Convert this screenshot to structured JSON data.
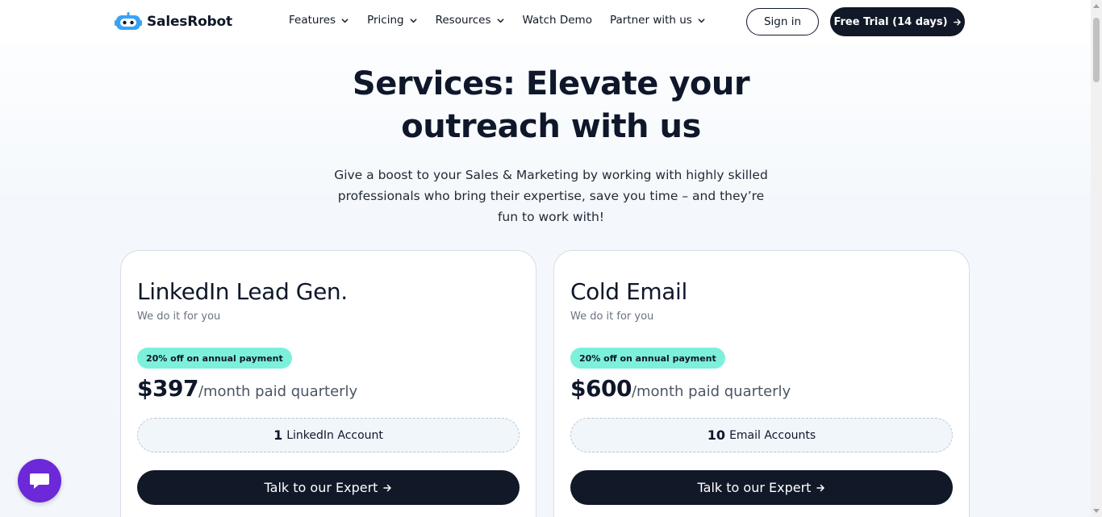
{
  "header": {
    "brand": "SalesRobot",
    "nav": [
      {
        "label": "Features",
        "has_dropdown": true
      },
      {
        "label": "Pricing",
        "has_dropdown": true
      },
      {
        "label": "Resources",
        "has_dropdown": true
      },
      {
        "label": "Watch Demo",
        "has_dropdown": false
      },
      {
        "label": "Partner with us",
        "has_dropdown": true
      }
    ],
    "signin_label": "Sign in",
    "trial_label": "Free Trial (14 days)"
  },
  "hero": {
    "title_line1": "Services: Elevate your",
    "title_line2": "outreach with us",
    "sub_line1": "Give a boost to your Sales & Marketing by working with highly skilled",
    "sub_line2": "professionals who bring their expertise, save you time – and they’re",
    "sub_line3": "fun to work with!"
  },
  "cards": [
    {
      "title": "LinkedIn Lead Gen.",
      "subtitle": "We do it for you",
      "badge": "20% off on annual payment",
      "price": "$397",
      "price_unit": "/month paid quarterly",
      "account_count": "1",
      "account_label": "LinkedIn Account",
      "cta": "Talk to our Expert"
    },
    {
      "title": "Cold Email",
      "subtitle": "We do it for you",
      "badge": "20% off on annual payment",
      "price": "$600",
      "price_unit": "/month paid quarterly",
      "account_count": "10",
      "account_label": "Email Accounts",
      "cta": "Talk to our Expert"
    }
  ],
  "icons": {
    "logo": "robot-logo-icon",
    "dropdown": "chevron-down-icon",
    "arrow": "arrow-right-icon",
    "chat": "chat-bubble-icon"
  },
  "colors": {
    "primary_dark": "#111827",
    "badge_bg": "#7df0dc",
    "chat_bg": "#6d28d9",
    "logo_blue": "#38a3f5"
  }
}
